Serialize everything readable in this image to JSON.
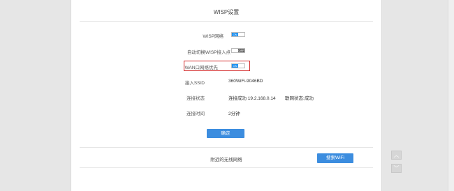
{
  "panel": {
    "title": "WISP设置"
  },
  "settings": {
    "wisp_network_label": "WISP网络",
    "wisp_network_state": "ON",
    "auto_switch_label": "自动切换WISP接入点",
    "auto_switch_state": "OFF",
    "wan_priority_label": "WAN口网络优先",
    "wan_priority_state": "ON"
  },
  "status": {
    "ssid_label": "接入SSID",
    "ssid_value": "360WiFi-9046BD",
    "connection_label": "连接状态",
    "connection_value": "连接成功 19.2.168.0.14",
    "network_status_label": "联网状态:",
    "network_status_value": "成功",
    "duration_label": "连接时间",
    "duration_value": "2分钟"
  },
  "actions": {
    "confirm_label": "确定",
    "nearby_title": "附近的无线网络",
    "search_label": "搜索WiFi"
  },
  "icons": {
    "scroll_up": "chevron-up-icon",
    "scroll_down": "chevron-down-icon"
  },
  "colors": {
    "accent": "#3c8ddf",
    "toggle_on": "#1b8ff0",
    "highlight": "#d42b2b"
  }
}
